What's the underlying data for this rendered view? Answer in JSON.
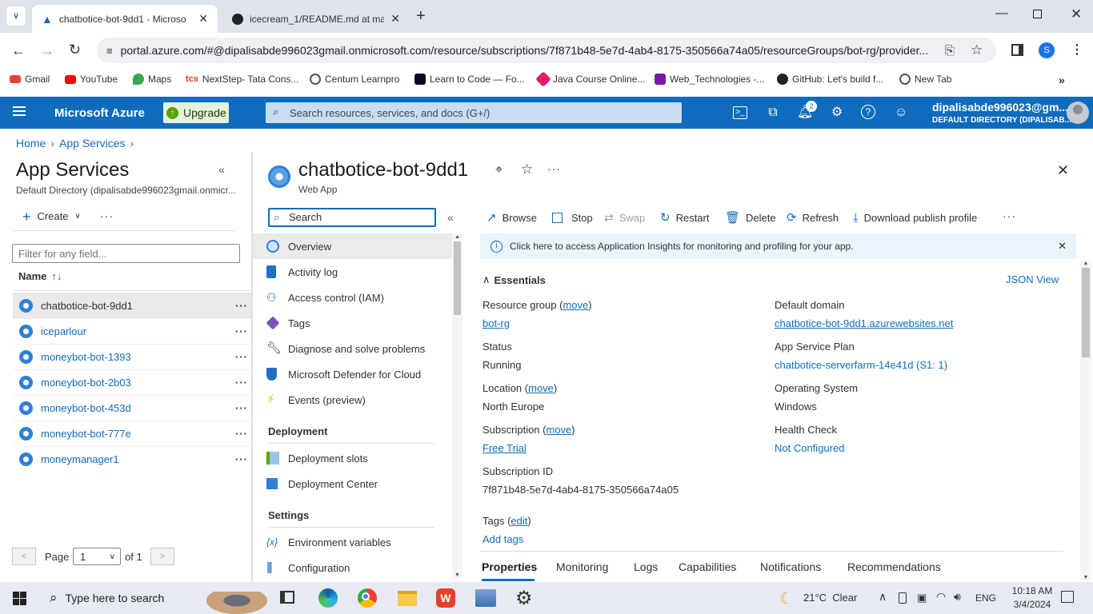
{
  "browser": {
    "tabs": [
      {
        "title": "chatbotice-bot-9dd1 - Microso"
      },
      {
        "title": "icecream_1/README.md at ma"
      }
    ],
    "url": "portal.azure.com/#@dipalisabde996023gmail.onmicrosoft.com/resource/subscriptions/7f871b48-5e7d-4ab4-8175-350566a74a05/resourceGroups/bot-rg/provider...",
    "profile_initial": "S",
    "bookmarks": [
      "Gmail",
      "YouTube",
      "Maps",
      "NextStep- Tata Cons...",
      "Centum Learnpro",
      "Learn to Code — Fo...",
      "Java Course Online...",
      "Web_Technologies -...",
      "GitHub: Let's build f...",
      "New Tab"
    ]
  },
  "azure": {
    "brand": "Microsoft Azure",
    "upgrade_label": "Upgrade",
    "search_placeholder": "Search resources, services, and docs (G+/)",
    "notifications_count": "2",
    "account_name": "dipalisabde996023@gm...",
    "account_directory": "DEFAULT DIRECTORY (DIPALISAB..."
  },
  "breadcrumb": {
    "home": "Home",
    "app_services": "App Services"
  },
  "left_blade": {
    "title": "App Services",
    "subtitle": "Default Directory (dipalisabde996023gmail.onmicr...",
    "create_label": "Create",
    "filter_placeholder": "Filter for any field...",
    "name_header": "Name",
    "apps": [
      "chatbotice-bot-9dd1",
      "iceparlour",
      "moneybot-bot-1393",
      "moneybot-bot-2b03",
      "moneybot-bot-453d",
      "moneybot-bot-777e",
      "moneymanager1"
    ],
    "page_label": "Page",
    "page_value": "1",
    "page_of": "of 1"
  },
  "resource": {
    "title": "chatbotice-bot-9dd1",
    "type": "Web App",
    "menu_search_placeholder": "Search",
    "menu_items": [
      "Overview",
      "Activity log",
      "Access control (IAM)",
      "Tags",
      "Diagnose and solve problems",
      "Microsoft Defender for Cloud",
      "Events (preview)"
    ],
    "deployment_header": "Deployment",
    "deployment_items": [
      "Deployment slots",
      "Deployment Center"
    ],
    "settings_header": "Settings",
    "settings_items": [
      "Environment variables",
      "Configuration"
    ]
  },
  "commands": {
    "browse": "Browse",
    "stop": "Stop",
    "swap": "Swap",
    "restart": "Restart",
    "delete": "Delete",
    "refresh": "Refresh",
    "download": "Download publish profile"
  },
  "banner": "Click here to access Application Insights for monitoring and profiling for your app.",
  "essentials": {
    "header": "Essentials",
    "json_view": "JSON View",
    "move": "move",
    "edit": "edit",
    "resource_group_label": "Resource group",
    "resource_group": "bot-rg",
    "status_label": "Status",
    "status": "Running",
    "location_label": "Location",
    "location": "North Europe",
    "subscription_label": "Subscription",
    "subscription": "Free Trial",
    "subscription_id_label": "Subscription ID",
    "subscription_id": "7f871b48-5e7d-4ab4-8175-350566a74a05",
    "tags_label": "Tags",
    "add_tags": "Add tags",
    "domain_label": "Default domain",
    "domain": "chatbotice-bot-9dd1.azurewebsites.net",
    "plan_label": "App Service Plan",
    "plan": "chatbotice-serverfarm-14e41d (S1: 1)",
    "os_label": "Operating System",
    "os": "Windows",
    "health_label": "Health Check",
    "health": "Not Configured"
  },
  "bottom_tabs": [
    "Properties",
    "Monitoring",
    "Logs",
    "Capabilities",
    "Notifications",
    "Recommendations"
  ],
  "taskbar": {
    "search_placeholder": "Type here to search",
    "weather": "21°C  Clear",
    "lang": "ENG",
    "time": "10:18 AM",
    "date": "3/4/2024"
  },
  "colors": {
    "azure_blue": "#0f6cbd",
    "upgrade_green": "#57a300"
  }
}
